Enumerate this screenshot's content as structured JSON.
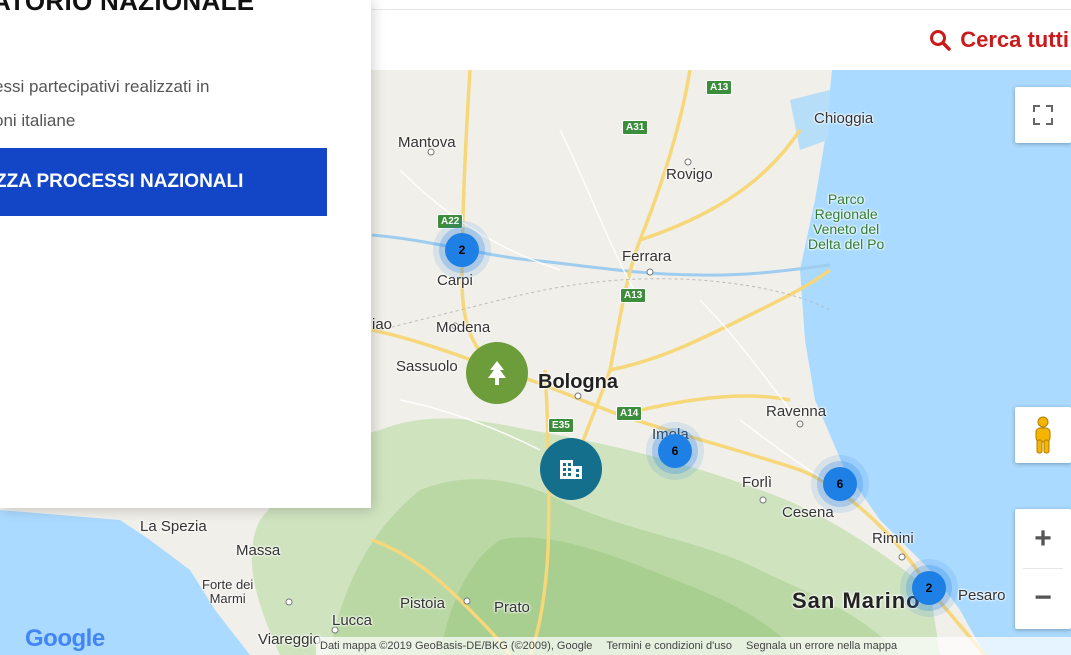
{
  "panel": {
    "title": "ATORIO NAZIONALE",
    "description_line1": "essi partecipativi realizzati in",
    "description_line2": "oni italiane",
    "cta_label": "ZZA PROCESSI NAZIONALI"
  },
  "header": {
    "search_all_label": "Cerca tutti"
  },
  "map": {
    "places": {
      "chioggia": "Chioggia",
      "mantova": "Mantova",
      "rovigo": "Rovigo",
      "parco": "Parco",
      "regionale": "Regionale",
      "veneto_del": "Veneto del",
      "delta_del_po": "Delta del Po",
      "ferrara": "Ferrara",
      "carpi": "Carpi",
      "modena": "Modena",
      "sassuolo": "Sassuolo",
      "bologna": "Bologna",
      "ravenna": "Ravenna",
      "imola": "Imola",
      "forli": "Forlì",
      "cesena": "Cesena",
      "rimini": "Rimini",
      "la_spezia": "La Spezia",
      "massa": "Massa",
      "forte_dei": "Forte dei",
      "marmi": "Marmi",
      "pistoia": "Pistoia",
      "prato": "Prato",
      "lucca": "Lucca",
      "viareggio": "Viareggio",
      "san_marino": "San Marino",
      "pesaro": "Pesaro",
      "fragment_left": "iao"
    },
    "road_shields": {
      "a13_top": "A13",
      "a31": "A31",
      "a22": "A22",
      "a13_mid": "A13",
      "e35": "E35",
      "a14": "A14"
    },
    "clusters": {
      "carpi": "2",
      "imola": "6",
      "cesena": "6",
      "san_marino": "2"
    },
    "google_logo": "Google",
    "attribution": {
      "data": "Dati mappa ©2019 GeoBasis-DE/BKG (©2009), Google",
      "terms": "Termini e condizioni d'uso",
      "report": "Segnala un errore nella mappa"
    },
    "controls": {
      "zoom_in": "+",
      "zoom_out": "−"
    }
  },
  "colors": {
    "accent_red": "#c91b1b",
    "cta_blue": "#1346c7",
    "cluster_blue": "#1e7fe5",
    "marker_green": "#6d9c3a",
    "marker_teal": "#136f8c",
    "sea": "#aadaff"
  }
}
